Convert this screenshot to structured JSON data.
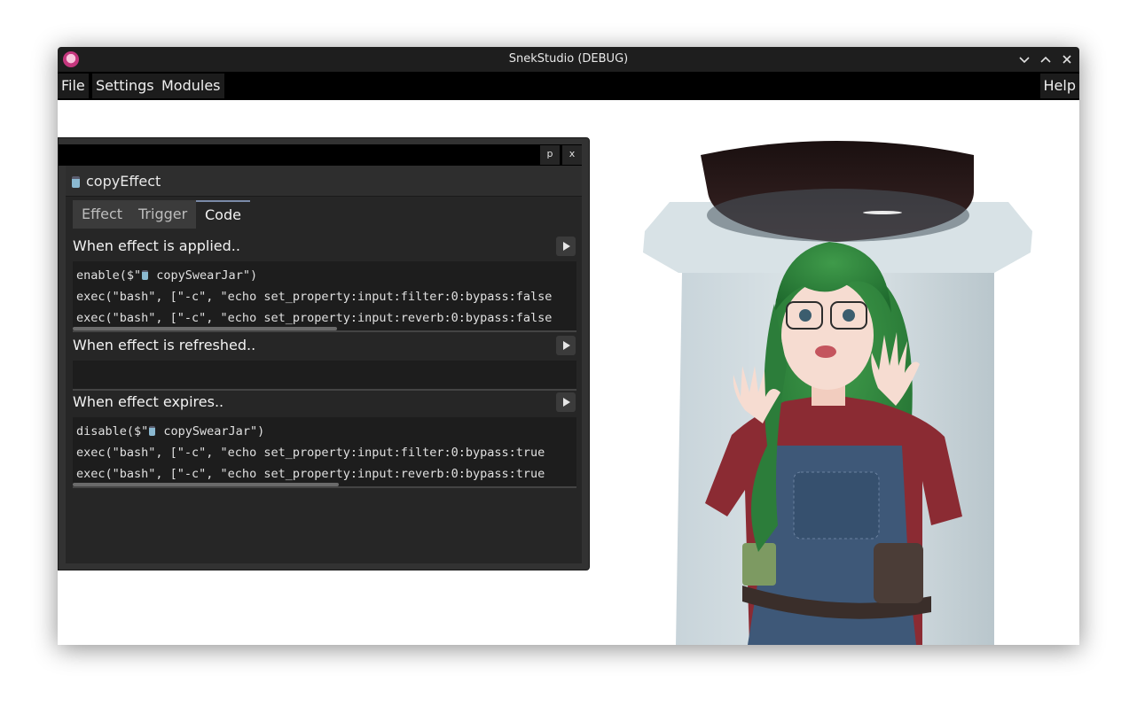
{
  "window": {
    "title": "SnekStudio (DEBUG)"
  },
  "menu": {
    "file": "File",
    "settings": "Settings",
    "modules": "Modules",
    "help": "Help"
  },
  "panel": {
    "pin_label": "p",
    "close_label": "x",
    "effect_name": "copyEffect",
    "tabs": [
      {
        "label": "Effect",
        "active": false
      },
      {
        "label": "Trigger",
        "active": false
      },
      {
        "label": "Code",
        "active": true
      }
    ],
    "sections": [
      {
        "title": "When effect is applied..",
        "lines": [
          {
            "pre": "enable($\"",
            "jar": true,
            "post": " copySwearJar\")"
          },
          {
            "pre": "exec(\"bash\", [\"-c\", \"echo set_property:input:filter:0:bypass:false",
            "jar": false,
            "post": ""
          },
          {
            "pre": "exec(\"bash\", [\"-c\", \"echo set_property:input:reverb:0:bypass:false",
            "jar": false,
            "post": ""
          }
        ]
      },
      {
        "title": "When effect is refreshed..",
        "lines": []
      },
      {
        "title": "When effect expires..",
        "lines": [
          {
            "pre": "disable($\"",
            "jar": true,
            "post": " copySwearJar\")"
          },
          {
            "pre": "exec(\"bash\", [\"-c\", \"echo set_property:input:filter:0:bypass:true",
            "jar": false,
            "post": ""
          },
          {
            "pre": "exec(\"bash\", [\"-c\", \"echo set_property:input:reverb:0:bypass:true",
            "jar": false,
            "post": ""
          }
        ]
      }
    ]
  }
}
